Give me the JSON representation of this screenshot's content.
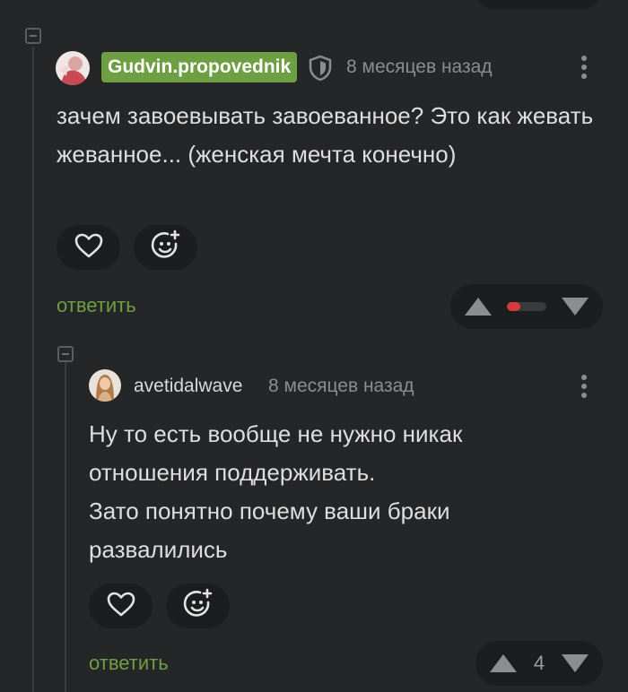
{
  "colors": {
    "background": "#252628",
    "surface": "#1c1d1f",
    "accent_green": "#6ea043",
    "downvote_red": "#d73a3a",
    "muted_text": "#8b8d91"
  },
  "comments": [
    {
      "author": "Gudvin.propovednik",
      "author_badge_style": "green-highlight",
      "verified_icon": "shield-icon",
      "time": "8 месяцев назад",
      "text": "зачем завоевывать завоеванное? Это как жевать жеванное... (женская мечта конечно)",
      "actions": {
        "like_icon": "heart-icon",
        "react_icon": "smiley-plus-icon"
      },
      "reply_label": "ответить",
      "rating": {
        "display": "bar",
        "negative_share": 0.35
      }
    },
    {
      "author": "avetidalwave",
      "time": "8 месяцев назад",
      "text_lines": [
        "Ну то есть вообще не нужно никак",
        "отношения поддерживать.",
        "Зато понятно почему ваши браки",
        "развалились"
      ],
      "actions": {
        "like_icon": "heart-icon",
        "react_icon": "smiley-plus-icon"
      },
      "reply_label": "ответить",
      "rating": {
        "display": "count",
        "value": "4"
      }
    }
  ]
}
